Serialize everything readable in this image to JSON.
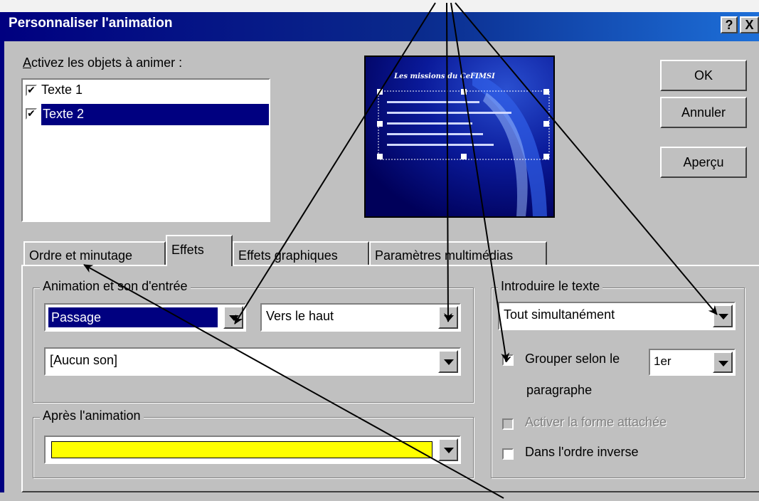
{
  "window": {
    "title": "Personnaliser l'animation",
    "help_button": "?",
    "close_button": "X"
  },
  "objects": {
    "label": "Activez les objets à animer :",
    "items": [
      {
        "label": "Texte 1",
        "checked": true,
        "selected": false
      },
      {
        "label": "Texte 2",
        "checked": true,
        "selected": true
      }
    ]
  },
  "preview": {
    "slide_title": "Les missions du CeFIMSI"
  },
  "buttons": {
    "ok": "OK",
    "cancel": "Annuler",
    "preview": "Aperçu"
  },
  "tabs": [
    {
      "label": "Ordre et minutage",
      "active": false
    },
    {
      "label": "Effets",
      "active": true
    },
    {
      "label": "Effets graphiques",
      "active": false
    },
    {
      "label": "Paramètres multimédias",
      "active": false
    }
  ],
  "entry": {
    "group_label": "Animation et son d'entrée",
    "effect": "Passage",
    "direction": "Vers le haut",
    "sound": "[Aucun son]"
  },
  "after": {
    "group_label": "Après l'animation",
    "color": "#ffff00"
  },
  "text_intro": {
    "group_label": "Introduire le texte",
    "mode": "Tout simultanément",
    "group_by_label": "Grouper selon le",
    "group_by_level": "1er",
    "group_by_suffix": "paragraphe",
    "group_by_checked": true,
    "attached_shape_label": "Activer la forme attachée",
    "attached_shape_checked": false,
    "reverse_label": "Dans l'ordre inverse",
    "reverse_checked": false
  },
  "colors": {
    "title_bar": "#000080",
    "dialog": "#c0c0c0",
    "selection": "#000080",
    "after_color": "#ffff00"
  }
}
